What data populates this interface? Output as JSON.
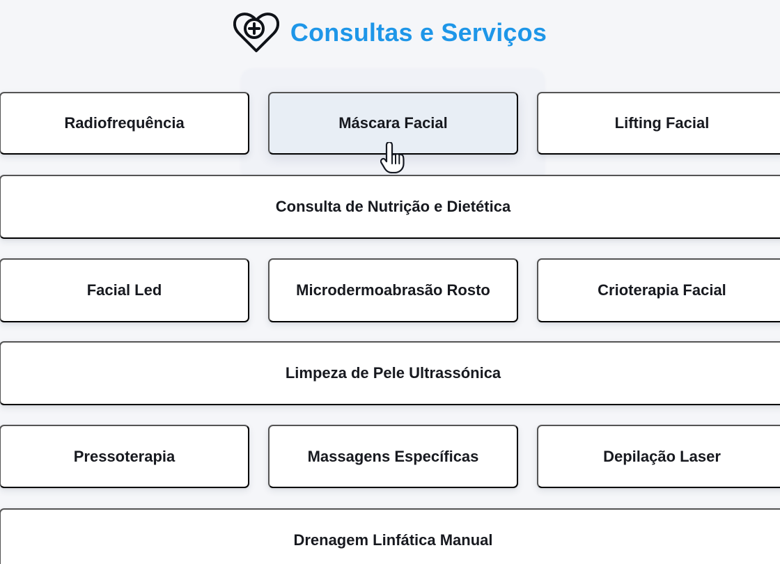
{
  "header": {
    "title": "Consultas e Serviços",
    "icon": "heart-plus-icon",
    "accent_color": "#1e96e8"
  },
  "services": [
    {
      "label": "Radiofrequência"
    },
    {
      "label": "Máscara Facial",
      "state": "selected"
    },
    {
      "label": "Lifting Facial"
    },
    {
      "label": "Consulta de Nutrição e Dietética"
    },
    {
      "label": "Facial Led"
    },
    {
      "label": "Microdermoabrasão Rosto"
    },
    {
      "label": "Crioterapia Facial"
    },
    {
      "label": "Limpeza de Pele Ultrassónica"
    },
    {
      "label": "Pressoterapia"
    },
    {
      "label": "Massagens Específicas"
    },
    {
      "label": "Depilação Laser"
    },
    {
      "label": "Drenagem Linfática Manual"
    }
  ],
  "cursor": {
    "icon": "hand-pointer-icon"
  }
}
